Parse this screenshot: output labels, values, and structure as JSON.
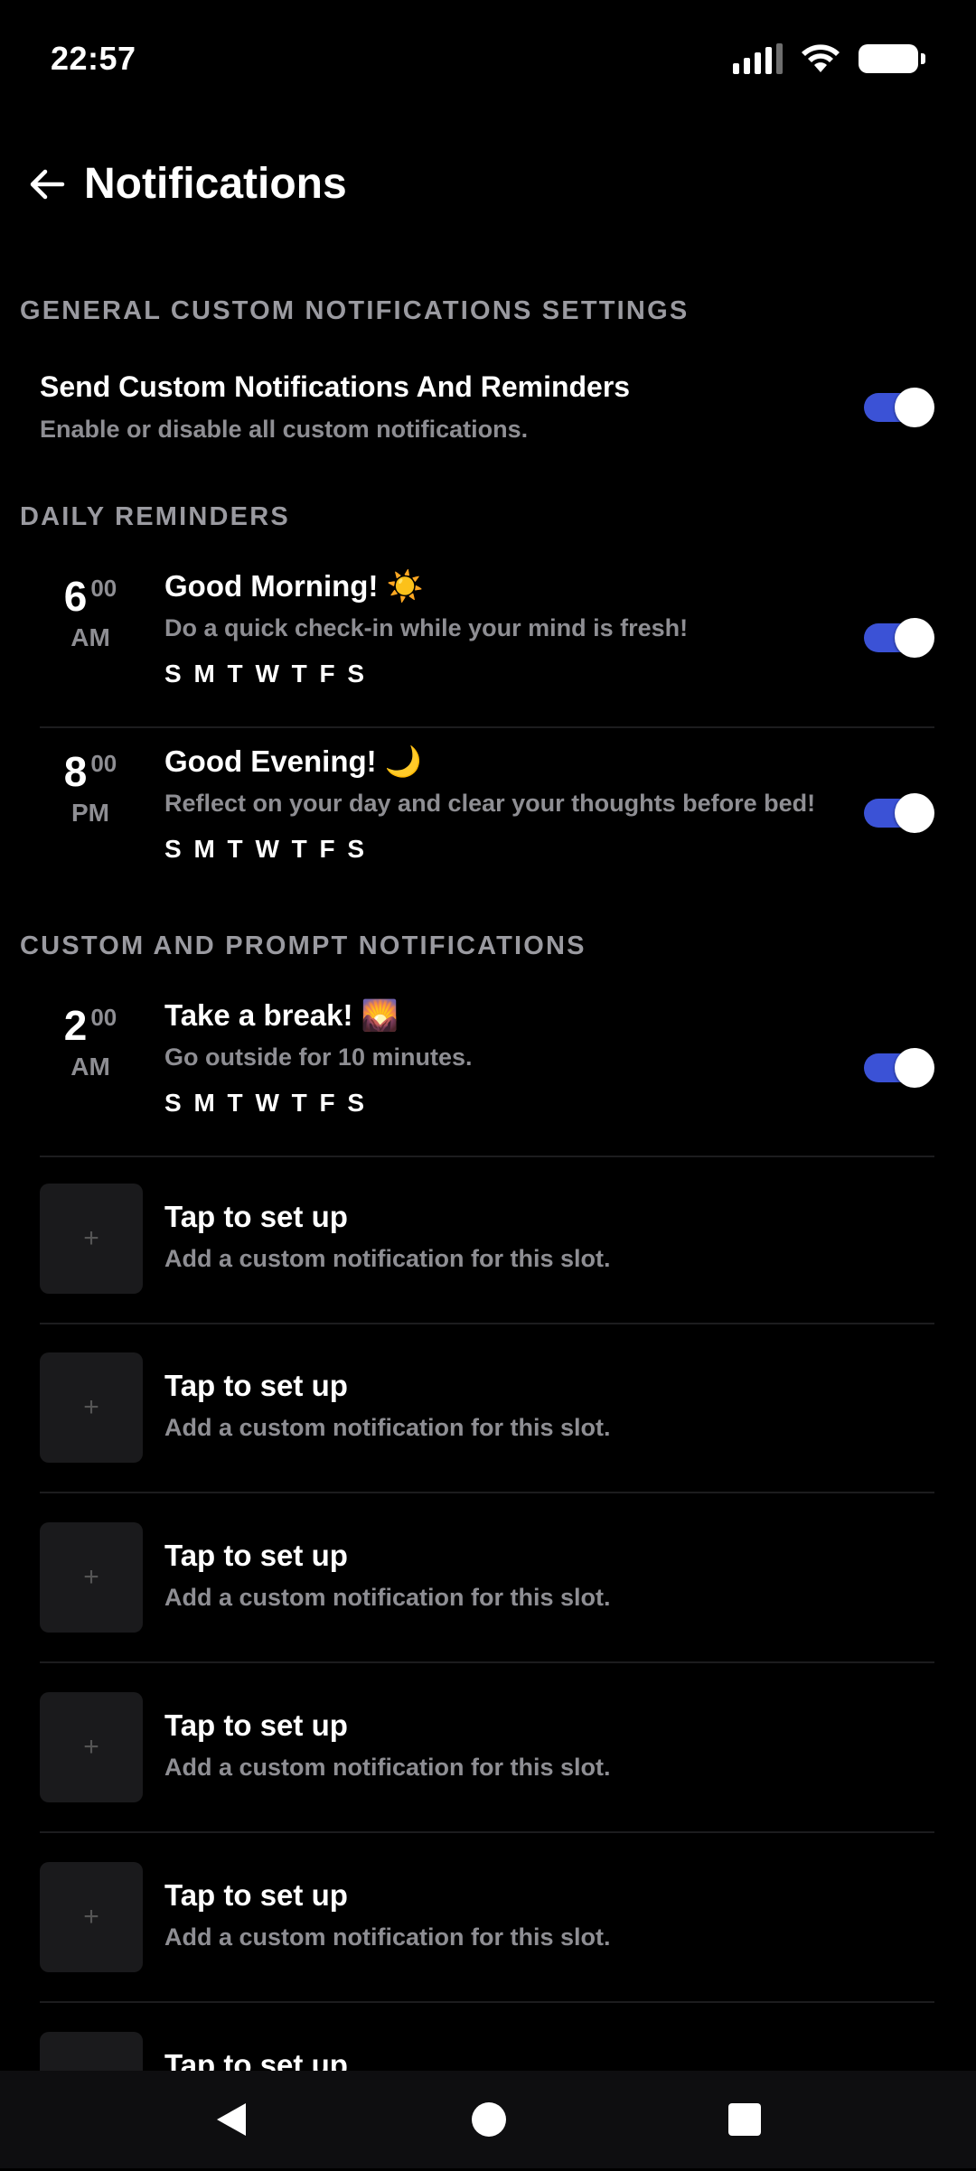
{
  "status_bar": {
    "time": "22:57",
    "icons": [
      "signal-icon",
      "wifi-icon",
      "battery-icon"
    ]
  },
  "header": {
    "title": "Notifications",
    "back_icon": "arrow-left-icon"
  },
  "colors": {
    "background": "#000000",
    "accent": "#3b52d6",
    "secondary_text": "#8e8e93",
    "section_text": "#9a9aa0"
  },
  "general": {
    "section_title": "GENERAL CUSTOM NOTIFICATIONS SETTINGS",
    "title": "Send Custom Notifications And Reminders",
    "subtitle": "Enable or disable all custom notifications.",
    "enabled": true
  },
  "daily": {
    "section_title": "DAILY REMINDERS",
    "items": [
      {
        "hour": "6",
        "minutes": "00",
        "ampm": "AM",
        "title": "Good Morning! ☀️",
        "description": "Do a quick check-in while your mind is fresh!",
        "days": "S M T W T F S",
        "enabled": true
      },
      {
        "hour": "8",
        "minutes": "00",
        "ampm": "PM",
        "title": "Good Evening! 🌙",
        "description": "Reflect on your day and clear your thoughts before bed!",
        "days": "S M T W T F S",
        "enabled": true
      }
    ]
  },
  "custom": {
    "section_title": "CUSTOM AND PROMPT NOTIFICATIONS",
    "items": [
      {
        "hour": "2",
        "minutes": "00",
        "ampm": "AM",
        "title": "Take a break! 🌄",
        "description": "Go outside for 10 minutes.",
        "days": "S M T W T F S",
        "enabled": true
      }
    ],
    "empty_slots": [
      {
        "plus": "+",
        "title": "Tap to set up",
        "subtitle": "Add a custom notification for this slot."
      },
      {
        "plus": "+",
        "title": "Tap to set up",
        "subtitle": "Add a custom notification for this slot."
      },
      {
        "plus": "+",
        "title": "Tap to set up",
        "subtitle": "Add a custom notification for this slot."
      },
      {
        "plus": "+",
        "title": "Tap to set up",
        "subtitle": "Add a custom notification for this slot."
      },
      {
        "plus": "+",
        "title": "Tap to set up",
        "subtitle": "Add a custom notification for this slot."
      },
      {
        "plus": "+",
        "title": "Tap to set up",
        "subtitle": ""
      }
    ]
  },
  "nav_bar": {
    "icons": [
      "nav-back-icon",
      "nav-home-icon",
      "nav-recents-icon"
    ]
  }
}
